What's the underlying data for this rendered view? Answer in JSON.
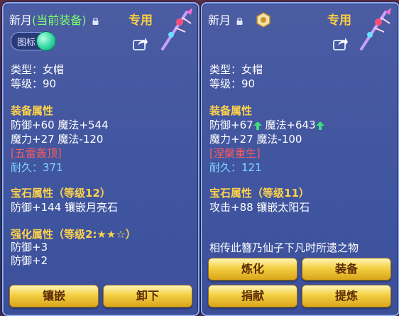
{
  "left_panel": {
    "name": "新月",
    "current_equip_tag": "(当前装备)",
    "exclusive": "专用",
    "icon_toggle_label": "图标",
    "type": "类型：女帽",
    "level": "等级：90",
    "equip_attr_header": "装备属性",
    "stat_line_1": "防御+60 魔法+544",
    "stat_line_2": "魔力+27 魔法-120",
    "special_skill": "[五雷轰顶]",
    "durability": "耐久：371",
    "gem_header": "宝石属性（等级12）",
    "gem_stats": "防御+144 镶嵌月亮石",
    "enhance_header": "强化属性（等级2:★★☆）",
    "enhance_line_1": "防御+3",
    "enhance_line_2": "防御+2",
    "buttons": {
      "inlay": "镶嵌",
      "remove": "卸下"
    }
  },
  "right_panel": {
    "name": "新月",
    "exclusive": "专用",
    "type": "类型：女帽",
    "level": "等级：90",
    "equip_attr_header": "装备属性",
    "stat_def": "防御+67",
    "stat_mag": "魔法+643",
    "stat_line_2": "魔力+27 魔法-100",
    "special_skill": "[涅槃重生]",
    "durability": "耐久：121",
    "gem_header": "宝石属性（等级11）",
    "gem_stats": "攻击+88 镶嵌太阳石",
    "lore": "相传此簪乃仙子下凡时所遗之物",
    "buttons": {
      "refine": "炼化",
      "equip": "装备",
      "donate": "捐献",
      "extract": "提炼"
    }
  },
  "colors": {
    "gold_text": "#ffd24a",
    "green_text": "#7dff6a",
    "aqua_text": "#7fd6ff",
    "red_text": "#ff5a5a",
    "button_gold": "#f3cf42"
  },
  "icons": [
    "lock-icon",
    "share-icon",
    "weapon-icon",
    "medal-icon",
    "up-arrow-icon",
    "toggle-knob"
  ]
}
